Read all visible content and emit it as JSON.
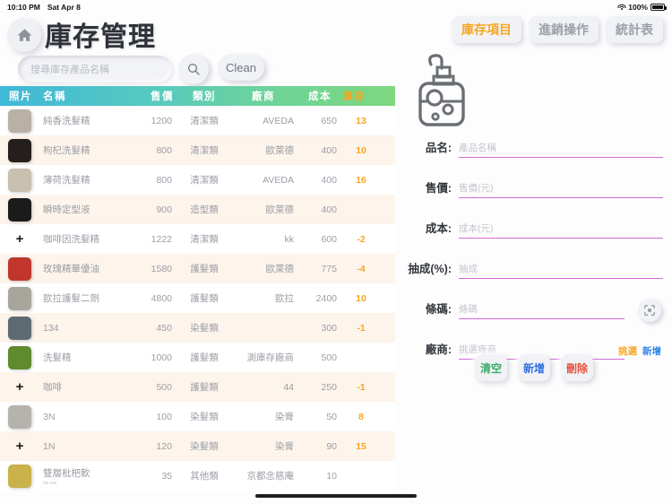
{
  "statusbar": {
    "time": "10:10 PM",
    "date": "Sat Apr 8",
    "battery": "100%"
  },
  "header": {
    "title": "庫存管理",
    "home_icon": "home-icon"
  },
  "search": {
    "placeholder": "搜尋庫存產品名稱",
    "search_icon": "search-icon",
    "clean_label": "Clean"
  },
  "tabs": [
    {
      "label": "庫存項目",
      "active": true
    },
    {
      "label": "進銷操作",
      "active": false
    },
    {
      "label": "統計表",
      "active": false
    }
  ],
  "table": {
    "columns": [
      "照片",
      "名稱",
      "售價",
      "類別",
      "廠商",
      "成本",
      "庫存"
    ],
    "rows": [
      {
        "photo": "thumb",
        "thumb_color": "#b9b1a6",
        "name": "純香洗髮精",
        "sub": "",
        "price": "1200",
        "category": "清潔類",
        "vendor": "AVEDA",
        "cost": "650",
        "stock": "13"
      },
      {
        "photo": "thumb",
        "thumb_color": "#241f1c",
        "name": "枸杞洗髮精",
        "sub": "",
        "price": "800",
        "category": "清潔類",
        "vendor": "歐萊德",
        "cost": "400",
        "stock": "10"
      },
      {
        "photo": "thumb",
        "thumb_color": "#c8bfae",
        "name": "薄荷洗髮精",
        "sub": "",
        "price": "800",
        "category": "清潔類",
        "vendor": "AVEDA",
        "cost": "400",
        "stock": "16"
      },
      {
        "photo": "thumb",
        "thumb_color": "#1b1b1b",
        "name": "瞬時定型液",
        "sub": "",
        "price": "900",
        "category": "造型類",
        "vendor": "歐萊德",
        "cost": "400",
        "stock": ""
      },
      {
        "photo": "plus",
        "thumb_color": "",
        "name": "咖啡因洗髮精",
        "sub": "",
        "price": "1222",
        "category": "清潔類",
        "vendor": "kk",
        "cost": "600",
        "stock": "-2"
      },
      {
        "photo": "thumb",
        "thumb_color": "#c0362c",
        "name": "玫瑰精華優油",
        "sub": "",
        "price": "1580",
        "category": "護髮類",
        "vendor": "歐萊德",
        "cost": "775",
        "stock": "-4"
      },
      {
        "photo": "thumb",
        "thumb_color": "#a8a59d",
        "name": "歐拉護髮二劑",
        "sub": "",
        "price": "4800",
        "category": "護髮類",
        "vendor": "歐拉",
        "cost": "2400",
        "stock": "10"
      },
      {
        "photo": "thumb",
        "thumb_color": "#5d6a72",
        "name": "134",
        "sub": "",
        "price": "450",
        "category": "染髮類",
        "vendor": "",
        "cost": "300",
        "stock": "-1"
      },
      {
        "photo": "thumb",
        "thumb_color": "#5f8a2e",
        "name": "洗髮精",
        "sub": "",
        "price": "1000",
        "category": "護髮類",
        "vendor": "測庫存廠商",
        "cost": "500",
        "stock": ""
      },
      {
        "photo": "plus",
        "thumb_color": "",
        "name": "咖啡",
        "sub": "",
        "price": "500",
        "category": "護髮類",
        "vendor": "44",
        "cost": "250",
        "stock": "-1"
      },
      {
        "photo": "thumb",
        "thumb_color": "#b6b3ae",
        "name": "3N",
        "sub": "",
        "price": "100",
        "category": "染髮類",
        "vendor": "染膏",
        "cost": "50",
        "stock": "8"
      },
      {
        "photo": "plus",
        "thumb_color": "",
        "name": "1N",
        "sub": "",
        "price": "120",
        "category": "染髮類",
        "vendor": "染膏",
        "cost": "90",
        "stock": "15"
      },
      {
        "photo": "thumb",
        "thumb_color": "#c9b24a",
        "name": "雙層枇杷軟",
        "sub": "ne ore",
        "price": "35",
        "category": "其他類",
        "vendor": "京都念慈庵",
        "cost": "10",
        "stock": ""
      }
    ]
  },
  "form": {
    "product_icon": "lotion-bottle-icon",
    "fields": [
      {
        "label": "品名:",
        "placeholder": "產品名稱"
      },
      {
        "label": "售價:",
        "placeholder": "售價(元)"
      },
      {
        "label": "成本:",
        "placeholder": "成本(元)"
      },
      {
        "label": "抽成(%):",
        "placeholder": "抽成"
      },
      {
        "label": "條碼:",
        "placeholder": "條碼"
      },
      {
        "label": "廠商:",
        "placeholder": "挑選廠商"
      }
    ],
    "scan_icon": "barcode-scan-icon",
    "vendor_pick_label": "挑選",
    "vendor_add_label": "新增",
    "actions": [
      {
        "label": "清空",
        "kind": "a-clear"
      },
      {
        "label": "新增",
        "kind": "a-add"
      },
      {
        "label": "刪除",
        "kind": "a-del"
      }
    ]
  },
  "colors": {
    "accent_orange": "#f5a623",
    "field_underline": "#d36ad8",
    "row_alt": "#fdf4ec"
  }
}
